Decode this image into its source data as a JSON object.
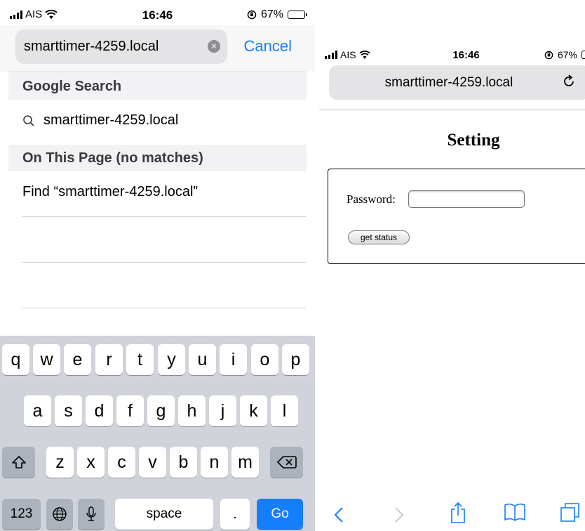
{
  "left_screen": {
    "status": {
      "carrier": "AIS",
      "time": "16:46",
      "battery": "67%"
    },
    "search": {
      "query": "smarttimer-4259.local",
      "cancel_label": "Cancel"
    },
    "google_section": {
      "header": "Google Search",
      "suggestion": "smarttimer-4259.local"
    },
    "page_section": {
      "header": "On This Page (no matches)",
      "find_label": "Find “smarttimer-4259.local”"
    },
    "keyboard": {
      "row1": [
        "q",
        "w",
        "e",
        "r",
        "t",
        "y",
        "u",
        "i",
        "o",
        "p"
      ],
      "row2": [
        "a",
        "s",
        "d",
        "f",
        "g",
        "h",
        "j",
        "k",
        "l"
      ],
      "row3": [
        "z",
        "x",
        "c",
        "v",
        "b",
        "n",
        "m"
      ],
      "numbers_label": "123",
      "space_label": "space",
      "period_label": ".",
      "go_label": "Go"
    }
  },
  "right_screen": {
    "status": {
      "carrier": "AIS",
      "time": "16:46",
      "battery": "67%"
    },
    "url": "smarttimer-4259.local",
    "page_title": "Setting",
    "password_label": "Password:",
    "password_value": "",
    "get_status_label": "get status"
  },
  "colors": {
    "accent": "#147efb",
    "keyboard_bg": "#d0d3d9",
    "field_bg": "#e4e4e6"
  }
}
